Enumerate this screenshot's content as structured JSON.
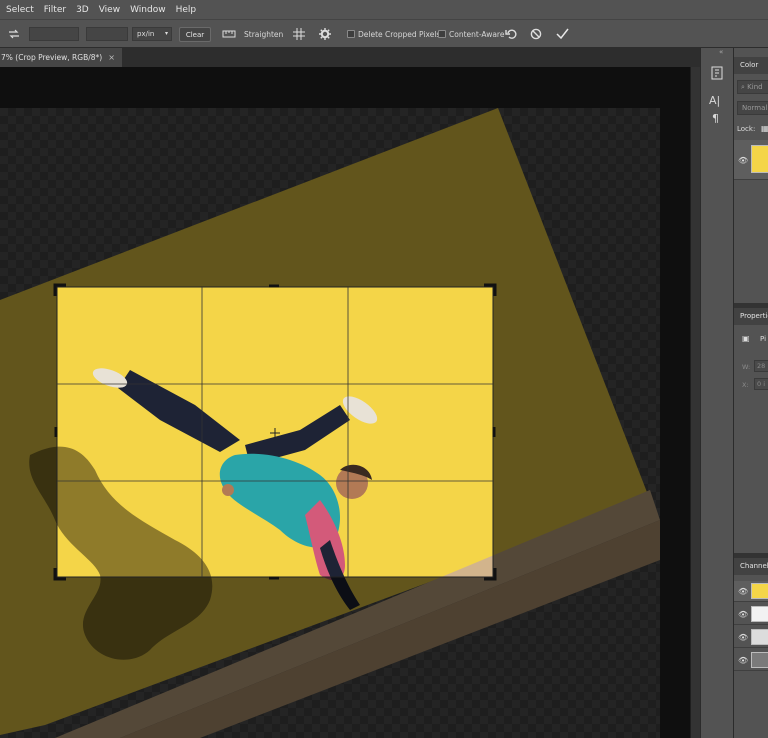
{
  "menu": [
    "Select",
    "Filter",
    "3D",
    "View",
    "Window",
    "Help"
  ],
  "options": {
    "resolution_unit": "px/in",
    "clear_label": "Clear",
    "straighten_label": "Straighten",
    "delete_cropped_label": "Delete Cropped Pixels",
    "content_aware_label": "Content-Aware"
  },
  "document_tab": {
    "title": "7% (Crop Preview, RGB/8*)",
    "close": "×"
  },
  "panels": {
    "color_tab": "Color",
    "kind_placeholder": "Kind",
    "blend_mode": "Normal",
    "lock_label": "Lock:",
    "properties_title": "Properties",
    "properties_type_abbrev": "Pi",
    "w_label": "W:",
    "w_value": "28",
    "x_label": "X:",
    "x_value": "0 i",
    "channels_title": "Channels"
  },
  "colors": {
    "photo_yellow": "#f6d84a",
    "ui_panel": "#535353",
    "canvas_bg": "#262626"
  }
}
